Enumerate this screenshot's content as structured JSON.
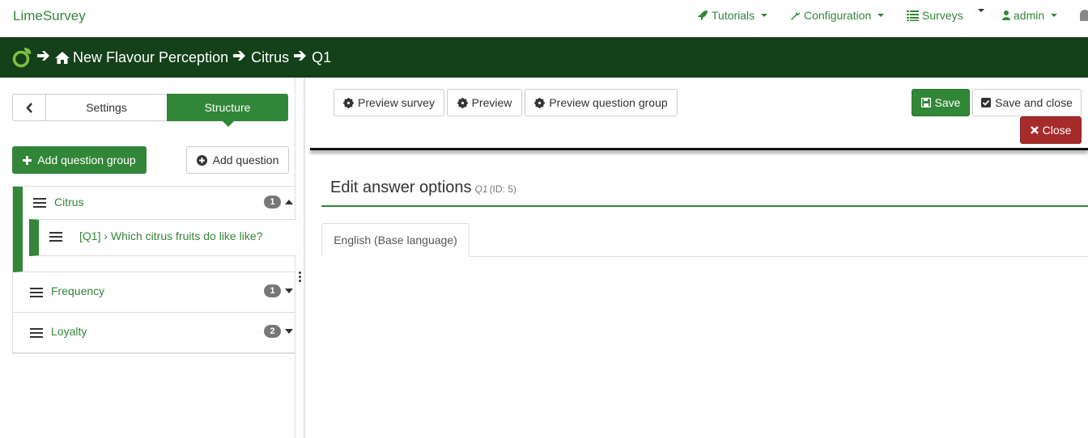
{
  "topnav": {
    "brand": "LimeSurvey",
    "tutorials": "Tutorials",
    "configuration": "Configuration",
    "surveys": "Surveys",
    "user": "admin"
  },
  "breadcrumb": {
    "survey": "New Flavour Perception",
    "group": "Citrus",
    "question": "Q1"
  },
  "sidebar": {
    "tab_settings": "Settings",
    "tab_structure": "Structure",
    "add_group": "Add question group",
    "add_question": "Add question",
    "groups": [
      {
        "name": "Citrus",
        "count": "1",
        "expanded": true,
        "questions": [
          {
            "label": "[Q1] › Which citrus fruits do like like?"
          }
        ]
      },
      {
        "name": "Frequency",
        "count": "1",
        "expanded": false
      },
      {
        "name": "Loyalty",
        "count": "2",
        "expanded": false
      }
    ]
  },
  "toolbar": {
    "preview_survey": "Preview survey",
    "preview": "Preview",
    "preview_group": "Preview question group",
    "save": "Save",
    "save_and_close": "Save and close",
    "close": "Close"
  },
  "main": {
    "title": "Edit answer options",
    "question_code": "Q1",
    "question_id": "(ID: 5)",
    "language_tab": "English (Base language)"
  },
  "colors": {
    "primary": "#328637",
    "breadcrumb_bg": "#14401a",
    "danger": "#a62b2b"
  }
}
